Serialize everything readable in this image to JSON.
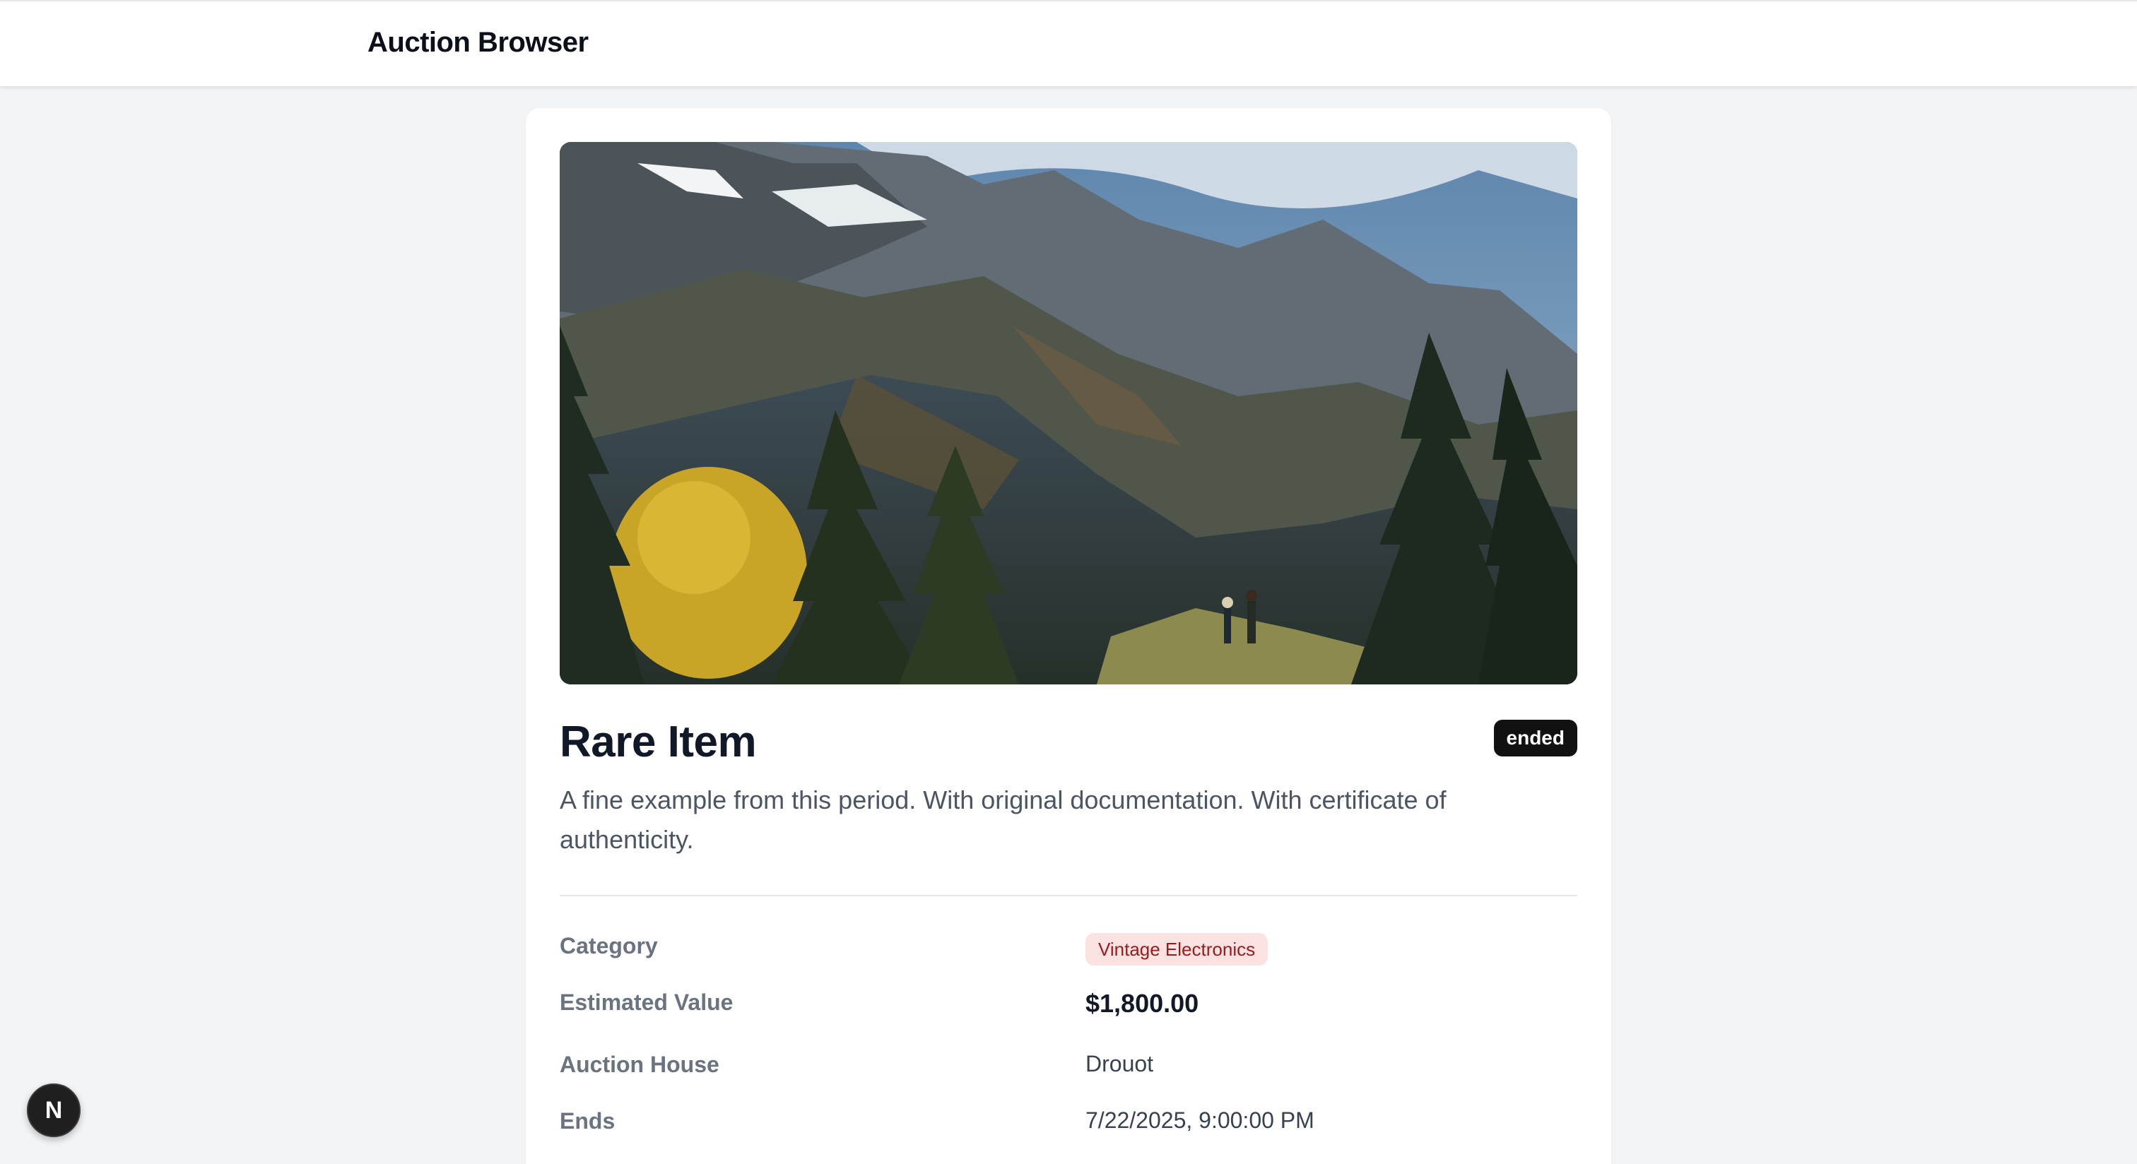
{
  "header": {
    "title": "Auction Browser"
  },
  "item": {
    "image_icon": "landscape-photo",
    "title": "Rare Item",
    "status": "ended",
    "description": "A fine example from this period. With original documentation. With certificate of authenticity."
  },
  "details": {
    "category_label": "Category",
    "category_value": "Vintage Electronics",
    "estimated_value_label": "Estimated Value",
    "estimated_value": "$1,800.00",
    "auction_house_label": "Auction House",
    "auction_house": "Drouot",
    "ends_label": "Ends",
    "ends": "7/22/2025, 9:00:00 PM"
  },
  "dev_badge": {
    "letter": "N"
  },
  "colors": {
    "page_bg": "#f3f4f6",
    "status_badge_bg": "#111111",
    "category_badge_bg": "#fde2e2",
    "category_badge_text": "#991b1b"
  }
}
